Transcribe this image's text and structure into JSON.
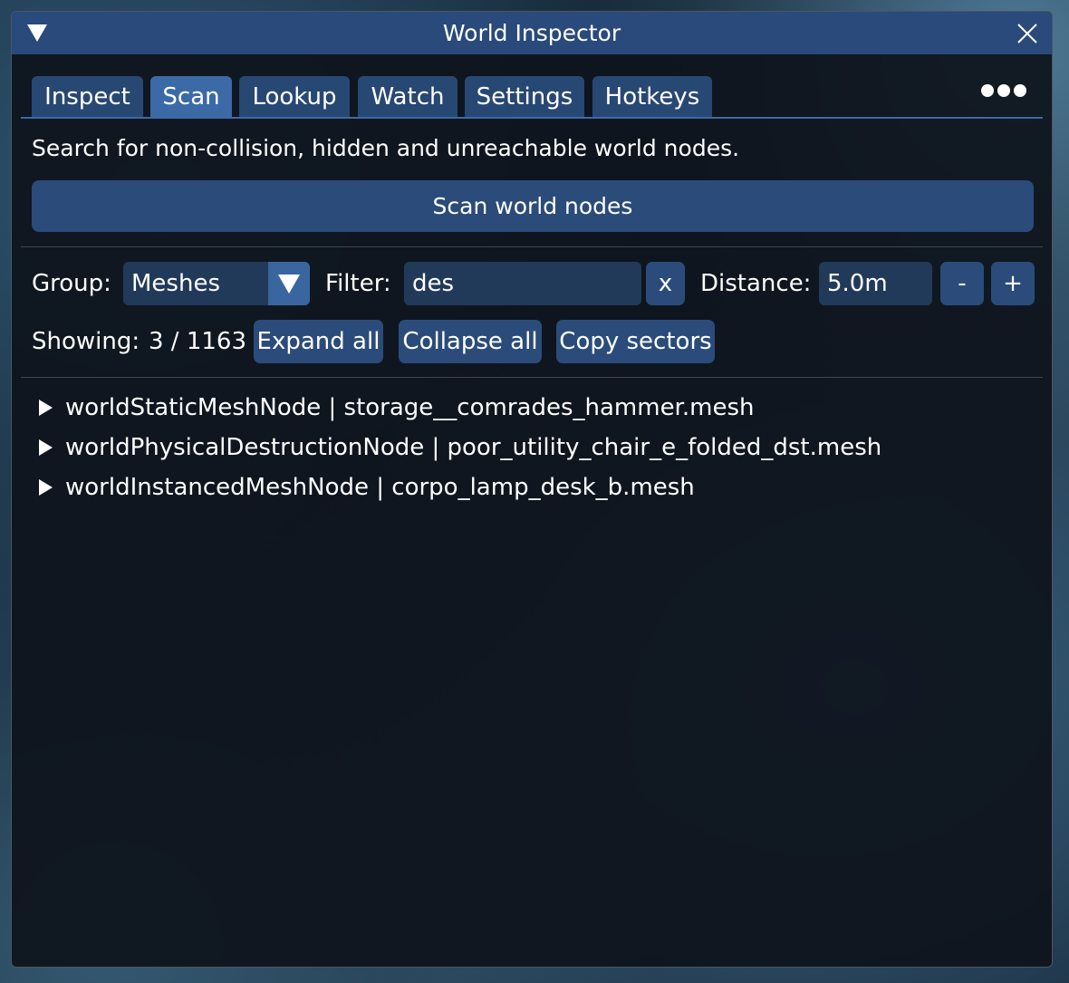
{
  "window": {
    "title": "World Inspector"
  },
  "tabs": [
    {
      "label": "Inspect",
      "active": false
    },
    {
      "label": "Scan",
      "active": true
    },
    {
      "label": "Lookup",
      "active": false
    },
    {
      "label": "Watch",
      "active": false
    },
    {
      "label": "Settings",
      "active": false
    },
    {
      "label": "Hotkeys",
      "active": false
    }
  ],
  "scan": {
    "description": "Search for non-collision, hidden and unreachable world nodes.",
    "scan_button": "Scan world nodes"
  },
  "controls": {
    "group_label": "Group:",
    "group_value": "Meshes",
    "filter_label": "Filter:",
    "filter_value": "des",
    "filter_clear": "x",
    "distance_label": "Distance:",
    "distance_value": "5.0m",
    "decrease": "-",
    "increase": "+"
  },
  "results": {
    "showing_label": "Showing:",
    "showing_count": "3 / 1163",
    "expand_all": "Expand all",
    "collapse_all": "Collapse all",
    "copy_sectors": "Copy sectors",
    "items": [
      "worldStaticMeshNode | storage__comrades_hammer.mesh",
      "worldPhysicalDestructionNode | poor_utility_chair_e_folded_dst.mesh",
      "worldInstancedMeshNode | corpo_lamp_desk_b.mesh"
    ]
  },
  "colors": {
    "titlebar": "#294a7a",
    "tab": "#284874",
    "tab_active": "#3b6aa6",
    "button": "#2b4c7a",
    "field": "#223a5a",
    "window_bg": "#0e131c"
  },
  "icons": {
    "collapse": "collapse-triangle-icon",
    "close": "close-icon",
    "more": "more-dots-icon",
    "dropdown": "chevron-down-icon",
    "tree": "tree-expand-arrow-icon"
  }
}
